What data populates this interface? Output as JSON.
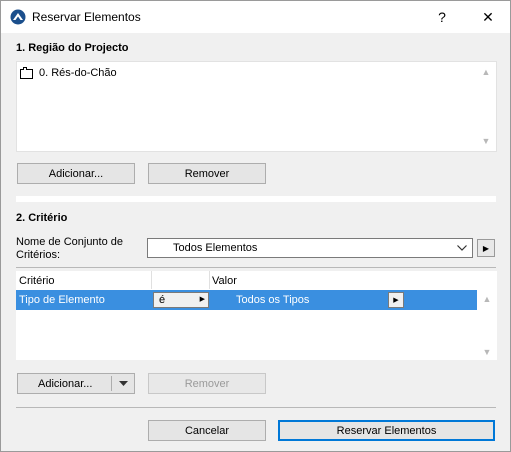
{
  "window": {
    "title": "Reservar Elementos",
    "help_label": "?",
    "close_label": "✕"
  },
  "region": {
    "heading": "1. Região do Projecto",
    "items": [
      {
        "label": "0. Rés-do-Chão",
        "icon": "story-icon"
      }
    ],
    "add_label": "Adicionar...",
    "remove_label": "Remover"
  },
  "criteria": {
    "heading": "2. Critério",
    "set_label": "Nome de Conjunto de Critérios:",
    "set_value": "Todos Elementos",
    "columns": {
      "criterion": "Critério",
      "operator": "",
      "value": "Valor"
    },
    "rows": [
      {
        "criterion": "Tipo de Elemento",
        "operator": "é",
        "value": "Todos os Tipos",
        "selected": true
      }
    ],
    "add_label": "Adicionar...",
    "remove_label": "Remover"
  },
  "footer": {
    "cancel_label": "Cancelar",
    "confirm_label": "Reservar Elementos"
  },
  "colors": {
    "selection": "#3a8fe0",
    "default_button_border": "#0078d7"
  }
}
